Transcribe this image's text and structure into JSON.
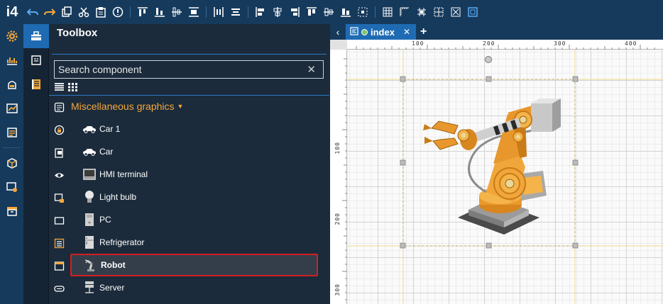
{
  "app": {
    "logo": "i4"
  },
  "toolbox": {
    "title": "Toolbox",
    "search_placeholder": "Search component",
    "category": "Miscellaneous graphics",
    "items": [
      {
        "label": "Car 1",
        "icon": "car-icon"
      },
      {
        "label": "Car",
        "icon": "car-icon"
      },
      {
        "label": "HMI terminal",
        "icon": "hmi-terminal-icon"
      },
      {
        "label": "Light bulb",
        "icon": "light-bulb-icon"
      },
      {
        "label": "PC",
        "icon": "pc-icon"
      },
      {
        "label": "Refrigerator",
        "icon": "refrigerator-icon"
      },
      {
        "label": "Robot",
        "icon": "robot-icon",
        "selected": true
      },
      {
        "label": "Server",
        "icon": "server-icon"
      }
    ]
  },
  "editor": {
    "tab_label": "index",
    "ruler_h": [
      "100",
      "200",
      "300",
      "400"
    ],
    "ruler_v": [
      "100",
      "200",
      "300"
    ]
  },
  "colors": {
    "accent": "#1f6bb3",
    "category": "#f4a73a",
    "selection": "#d21f24",
    "toolbar": "#163a5c"
  }
}
